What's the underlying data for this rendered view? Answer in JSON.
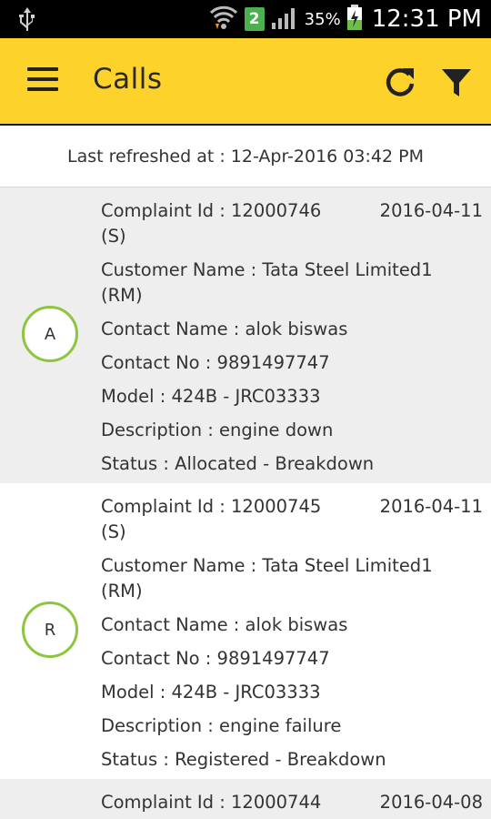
{
  "status_bar": {
    "battery_pct": "35%",
    "time": "12:31 PM",
    "notification_badge": "2",
    "icons": [
      "usb-icon",
      "wifi-icon",
      "signal-icon",
      "battery-charging-icon"
    ]
  },
  "toolbar": {
    "title": "Calls",
    "icons": [
      "menu-icon",
      "refresh-icon",
      "filter-icon"
    ],
    "color": "#fdd22a"
  },
  "last_refreshed": "Last refreshed at : 12-Apr-2016 03:42 PM",
  "calls": [
    {
      "initial": "A",
      "complaint_id": "Complaint Id : 12000746",
      "complaint_suffix": "(S)",
      "date": "2016-04-11",
      "customer_name": "Customer Name : Tata Steel Limited1",
      "customer_suffix": "(RM)",
      "contact_name": "Contact Name : alok biswas",
      "contact_no": "Contact No : 9891497747",
      "model": "Model : 424B - JRC03333",
      "description": "Description : engine down",
      "status": "Status : Allocated - Breakdown"
    },
    {
      "initial": "R",
      "complaint_id": "Complaint Id : 12000745",
      "complaint_suffix": "(S)",
      "date": "2016-04-11",
      "customer_name": "Customer Name : Tata Steel Limited1",
      "customer_suffix": "(RM)",
      "contact_name": "Contact Name : alok biswas",
      "contact_no": "Contact No : 9891497747",
      "model": "Model : 424B - JRC03333",
      "description": "Description : engine failure",
      "status": "Status : Registered - Breakdown"
    },
    {
      "complaint_id": "Complaint Id : 12000744",
      "date": "2016-04-08"
    }
  ],
  "colors": {
    "avatar_ring": "#8cc63f",
    "row_alt_bg": "#eeeeee"
  }
}
